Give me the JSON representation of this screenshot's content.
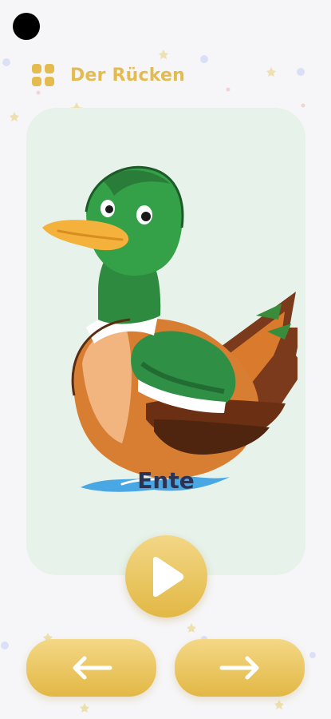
{
  "header": {
    "title": "Der Rücken",
    "menu_icon": "grid-icon"
  },
  "card": {
    "word": "Ente",
    "image": "duck-illustration"
  },
  "controls": {
    "play_icon": "play-icon",
    "prev_icon": "arrow-left-icon",
    "next_icon": "arrow-right-icon"
  },
  "colors": {
    "accent": "#e3bb51",
    "card_background": "#e6f2ea",
    "page_background": "#f6f6f8",
    "word_text": "#2c3352"
  }
}
